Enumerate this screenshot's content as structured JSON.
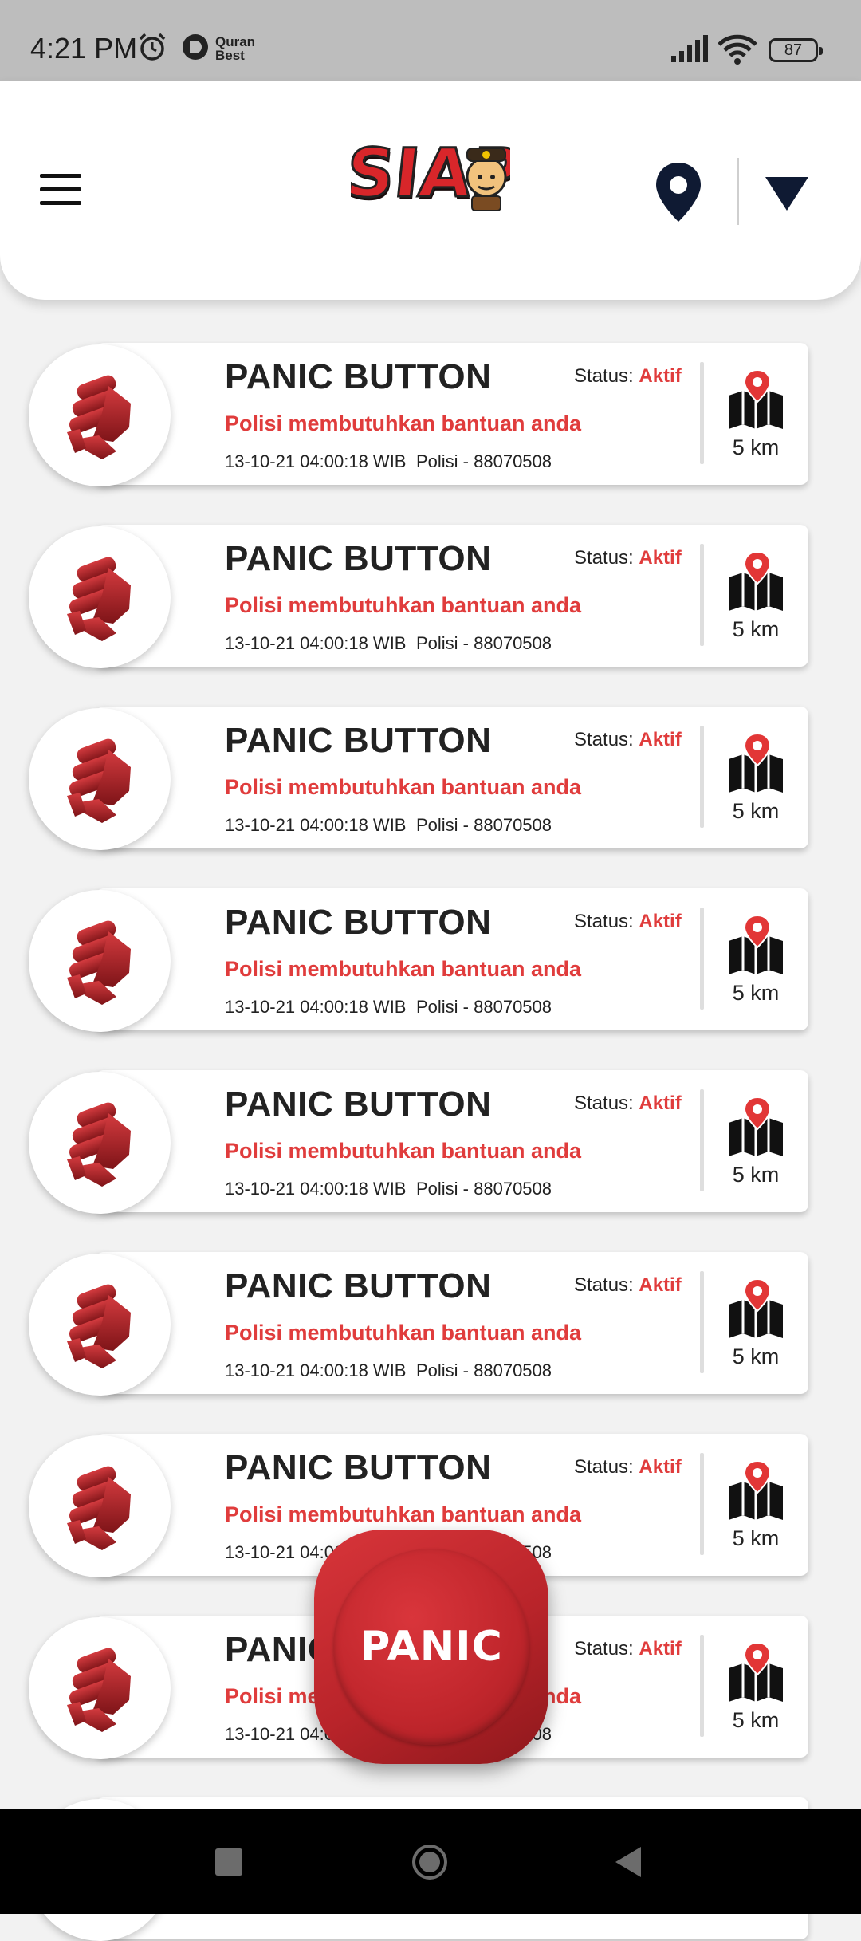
{
  "status_bar": {
    "time": "4:21 PM",
    "quran_line1": "Quran",
    "quran_line2": "Best",
    "battery": "87"
  },
  "header": {
    "logo_text": "SIAP"
  },
  "cards": [
    {
      "title": "PANIC BUTTON",
      "subtitle": "Polisi membutuhkan bantuan anda",
      "date": "13-10-21 04:00:18 WIB",
      "unit": "Polisi - 88070508",
      "status_label": "Status: ",
      "status_value": "Aktif",
      "distance": "5 km"
    },
    {
      "title": "PANIC BUTTON",
      "subtitle": "Polisi membutuhkan bantuan anda",
      "date": "13-10-21 04:00:18 WIB",
      "unit": "Polisi - 88070508",
      "status_label": "Status: ",
      "status_value": "Aktif",
      "distance": "5 km"
    },
    {
      "title": "PANIC BUTTON",
      "subtitle": "Polisi membutuhkan bantuan anda",
      "date": "13-10-21 04:00:18 WIB",
      "unit": "Polisi - 88070508",
      "status_label": "Status: ",
      "status_value": "Aktif",
      "distance": "5 km"
    },
    {
      "title": "PANIC BUTTON",
      "subtitle": "Polisi membutuhkan bantuan anda",
      "date": "13-10-21 04:00:18 WIB",
      "unit": "Polisi - 88070508",
      "status_label": "Status: ",
      "status_value": "Aktif",
      "distance": "5 km"
    },
    {
      "title": "PANIC BUTTON",
      "subtitle": "Polisi membutuhkan bantuan anda",
      "date": "13-10-21 04:00:18 WIB",
      "unit": "Polisi - 88070508",
      "status_label": "Status: ",
      "status_value": "Aktif",
      "distance": "5 km"
    },
    {
      "title": "PANIC BUTTON",
      "subtitle": "Polisi membutuhkan bantuan anda",
      "date": "13-10-21 04:00:18 WIB",
      "unit": "Polisi - 88070508",
      "status_label": "Status: ",
      "status_value": "Aktif",
      "distance": "5 km"
    },
    {
      "title": "PANIC BUTTON",
      "subtitle": "Polisi membutuhkan bantuan anda",
      "date": "13-10-21 04:00:18 WIB",
      "unit": "Polisi - 88070508",
      "status_label": "Status: ",
      "status_value": "Aktif",
      "distance": "5 km"
    },
    {
      "title": "PANIC BUTTON",
      "subtitle": "Polisi membutuhkan bantuan anda",
      "date": "13-10-21 04:00:18 WIB",
      "unit": "Polisi - 88070508",
      "status_label": "Status: ",
      "status_value": "Aktif",
      "distance": "5 km"
    }
  ],
  "panic_button": {
    "label": "PANIC"
  },
  "colors": {
    "accent": "#e03c3c",
    "panic": "#c0262c",
    "navy": "#0f1a33"
  },
  "icons": {
    "menu": "hamburger-menu-icon",
    "location": "location-pin-icon",
    "filter": "triangle-down-icon",
    "card_avatar": "fist-icon",
    "card_map": "map-pin-icon",
    "nav_recents": "square-icon",
    "nav_home": "circle-icon",
    "nav_back": "back-triangle-icon"
  }
}
